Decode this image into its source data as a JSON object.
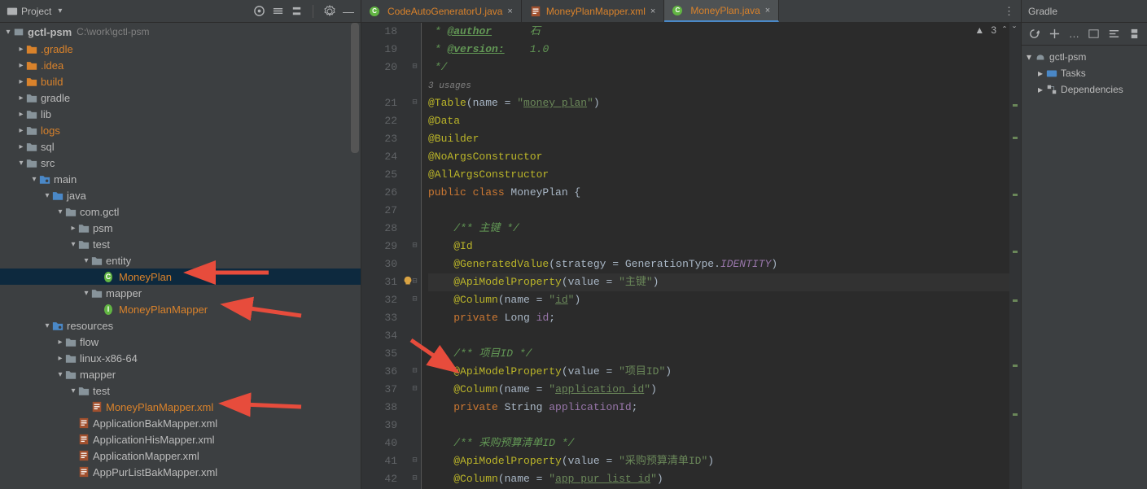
{
  "project": {
    "panel_title": "Project",
    "root": {
      "name": "gctl-psm",
      "path": "C:\\work\\gctl-psm"
    },
    "tree": [
      {
        "label": ".gradle",
        "style": "orange",
        "depth": 1,
        "expanded": false,
        "icon": "folder-orange"
      },
      {
        "label": ".idea",
        "style": "orange",
        "depth": 1,
        "expanded": false,
        "icon": "folder-orange"
      },
      {
        "label": "build",
        "style": "orange",
        "depth": 1,
        "expanded": false,
        "icon": "folder-orange"
      },
      {
        "label": "gradle",
        "style": "normal",
        "depth": 1,
        "expanded": false,
        "icon": "folder"
      },
      {
        "label": "lib",
        "style": "normal",
        "depth": 1,
        "expanded": false,
        "icon": "folder"
      },
      {
        "label": "logs",
        "style": "orange",
        "depth": 1,
        "expanded": false,
        "icon": "folder"
      },
      {
        "label": "sql",
        "style": "normal",
        "depth": 1,
        "expanded": false,
        "icon": "folder"
      },
      {
        "label": "src",
        "style": "normal",
        "depth": 1,
        "expanded": true,
        "icon": "folder"
      },
      {
        "label": "main",
        "style": "normal",
        "depth": 2,
        "expanded": true,
        "icon": "folder-src"
      },
      {
        "label": "java",
        "style": "normal",
        "depth": 3,
        "expanded": true,
        "icon": "folder-blue"
      },
      {
        "label": "com.gctl",
        "style": "normal",
        "depth": 4,
        "expanded": true,
        "icon": "folder"
      },
      {
        "label": "psm",
        "style": "normal",
        "depth": 5,
        "expanded": false,
        "icon": "folder"
      },
      {
        "label": "test",
        "style": "normal",
        "depth": 5,
        "expanded": true,
        "icon": "folder"
      },
      {
        "label": "entity",
        "style": "normal",
        "depth": 6,
        "expanded": true,
        "icon": "folder"
      },
      {
        "label": "MoneyPlan",
        "style": "orange",
        "depth": 7,
        "expanded": null,
        "icon": "class",
        "selected": true
      },
      {
        "label": "mapper",
        "style": "normal",
        "depth": 6,
        "expanded": true,
        "icon": "folder"
      },
      {
        "label": "MoneyPlanMapper",
        "style": "orange",
        "depth": 7,
        "expanded": null,
        "icon": "interface"
      },
      {
        "label": "resources",
        "style": "normal",
        "depth": 3,
        "expanded": true,
        "icon": "folder-src"
      },
      {
        "label": "flow",
        "style": "normal",
        "depth": 4,
        "expanded": false,
        "icon": "folder"
      },
      {
        "label": "linux-x86-64",
        "style": "normal",
        "depth": 4,
        "expanded": false,
        "icon": "folder"
      },
      {
        "label": "mapper",
        "style": "normal",
        "depth": 4,
        "expanded": true,
        "icon": "folder"
      },
      {
        "label": "test",
        "style": "normal",
        "depth": 5,
        "expanded": true,
        "icon": "folder"
      },
      {
        "label": "MoneyPlanMapper.xml",
        "style": "orange",
        "depth": 6,
        "expanded": null,
        "icon": "xml"
      },
      {
        "label": "ApplicationBakMapper.xml",
        "style": "normal",
        "depth": 5,
        "expanded": null,
        "icon": "xml"
      },
      {
        "label": "ApplicationHisMapper.xml",
        "style": "normal",
        "depth": 5,
        "expanded": null,
        "icon": "xml"
      },
      {
        "label": "ApplicationMapper.xml",
        "style": "normal",
        "depth": 5,
        "expanded": null,
        "icon": "xml"
      },
      {
        "label": "AppPurListBakMapper.xml",
        "style": "normal",
        "depth": 5,
        "expanded": null,
        "icon": "xml"
      }
    ]
  },
  "tabs": [
    {
      "label": "CodeAutoGeneratorU.java",
      "icon": "class",
      "active": false
    },
    {
      "label": "MoneyPlanMapper.xml",
      "icon": "xml",
      "active": false
    },
    {
      "label": "MoneyPlan.java",
      "icon": "class",
      "active": true
    }
  ],
  "editor": {
    "warning_count": "3",
    "usages_hint": "3 usages",
    "lines": [
      {
        "n": 18,
        "fold": "",
        "html": " <span class='c-comment-g'>*</span> <span class='c-doctag'>@author</span>      <span class='c-comment-g'>石</span>"
      },
      {
        "n": 19,
        "fold": "",
        "html": " <span class='c-comment-g'>*</span> <span class='c-doctag'>@version:</span>    <span class='c-comment-g'>1.0</span>"
      },
      {
        "n": 20,
        "fold": "⊟",
        "html": " <span class='c-comment-g'>*/</span>"
      },
      {
        "n": null,
        "fold": "",
        "html": "<span class='c-comment' style='font-size:11px'>3 usages</span>"
      },
      {
        "n": 21,
        "fold": "⊟",
        "html": "<span class='c-anno'>@Table</span><span class='c-plain'>(name = </span><span class='c-str'>\"</span><span class='c-str-u'>money_plan</span><span class='c-str'>\"</span><span class='c-plain'>)</span>"
      },
      {
        "n": 22,
        "fold": "",
        "html": "<span class='c-anno'>@Data</span>"
      },
      {
        "n": 23,
        "fold": "",
        "html": "<span class='c-anno'>@Builder</span>"
      },
      {
        "n": 24,
        "fold": "",
        "html": "<span class='c-anno'>@NoArgsConstructor</span>"
      },
      {
        "n": 25,
        "fold": "",
        "html": "<span class='c-anno'>@AllArgsConstructor</span>"
      },
      {
        "n": 26,
        "fold": "",
        "html": "<span class='c-kw'>public class </span><span class='c-type'>MoneyPlan {</span>"
      },
      {
        "n": 27,
        "fold": "",
        "html": ""
      },
      {
        "n": 28,
        "fold": "",
        "html": "    <span class='c-comment-g'>/** 主键 */</span>"
      },
      {
        "n": 29,
        "fold": "⊟",
        "html": "    <span class='c-anno'>@Id</span>"
      },
      {
        "n": 30,
        "fold": "",
        "html": "    <span class='c-anno'>@GeneratedValue</span><span class='c-plain'>(strategy = GenerationType.</span><span class='c-it'>IDENTITY</span><span class='c-plain'>)</span>"
      },
      {
        "n": 31,
        "fold": "⊟",
        "hl": true,
        "bulb": true,
        "html": "    <span class='c-anno'>@ApiModelProperty</span><span class='c-plain'>(value = </span><span class='c-str'>\"主键\"</span><span class='c-plain'>)</span>"
      },
      {
        "n": 32,
        "fold": "⊟",
        "html": "    <span class='c-anno'>@Column</span><span class='c-plain'>(name = </span><span class='c-str'>\"</span><span class='c-str-u'>id</span><span class='c-str'>\"</span><span class='c-plain'>)</span>"
      },
      {
        "n": 33,
        "fold": "",
        "html": "    <span class='c-kw'>private </span><span class='c-type'>Long </span><span class='c-field'>id</span><span class='c-plain'>;</span>"
      },
      {
        "n": 34,
        "fold": "",
        "html": ""
      },
      {
        "n": 35,
        "fold": "",
        "html": "    <span class='c-comment-g'>/** 项目ID */</span>"
      },
      {
        "n": 36,
        "fold": "⊟",
        "html": "    <span class='c-anno'>@ApiModelProperty</span><span class='c-plain'>(value = </span><span class='c-str'>\"项目ID\"</span><span class='c-plain'>)</span>"
      },
      {
        "n": 37,
        "fold": "⊟",
        "html": "    <span class='c-anno'>@Column</span><span class='c-plain'>(name = </span><span class='c-str'>\"</span><span class='c-str-u'>application_id</span><span class='c-str'>\"</span><span class='c-plain'>)</span>"
      },
      {
        "n": 38,
        "fold": "",
        "html": "    <span class='c-kw'>private </span><span class='c-type'>String </span><span class='c-field'>applicationId</span><span class='c-plain'>;</span>"
      },
      {
        "n": 39,
        "fold": "",
        "html": ""
      },
      {
        "n": 40,
        "fold": "",
        "html": "    <span class='c-comment-g'>/** 采购预算清单ID */</span>"
      },
      {
        "n": 41,
        "fold": "⊟",
        "html": "    <span class='c-anno'>@ApiModelProperty</span><span class='c-plain'>(value = </span><span class='c-str'>\"采购预算清单ID\"</span><span class='c-plain'>)</span>"
      },
      {
        "n": 42,
        "fold": "⊟",
        "html": "    <span class='c-anno'>@Column</span><span class='c-plain'>(name = </span><span class='c-str'>\"</span><span class='c-str-u'>app_pur_list_id</span><span class='c-str'>\"</span><span class='c-plain'>)</span>"
      }
    ]
  },
  "gradle": {
    "title": "Gradle",
    "root": "gctl-psm",
    "items": [
      "Tasks",
      "Dependencies"
    ]
  }
}
